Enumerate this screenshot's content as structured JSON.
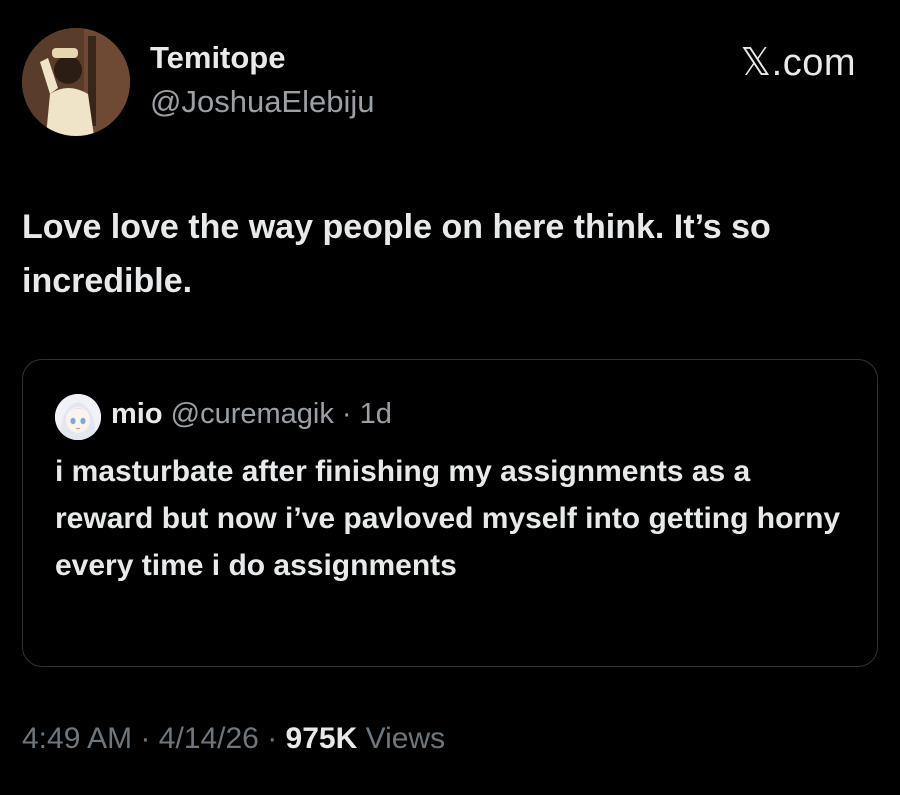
{
  "author": {
    "display_name": "Temitope",
    "handle": "@JoshuaElebiju"
  },
  "brand": "𝕏.com",
  "tweet": {
    "text": "Love love the way people on here think. It’s so incredible."
  },
  "quoted_tweet": {
    "display_name": "mio",
    "handle": "@curemagik",
    "separator": "·",
    "time": "1d",
    "text": "i masturbate after finishing my assignments as a reward but now i’ve pavloved myself into getting horny every time i do assignments"
  },
  "meta": {
    "time": "4:49 AM",
    "separator": "·",
    "date": "4/14/26",
    "views_count": "975K",
    "views_label": "Views"
  },
  "colors": {
    "background": "#000000",
    "primary_text": "#e7e9ea",
    "secondary_text": "#9aa0a6",
    "border": "#2f3336"
  }
}
